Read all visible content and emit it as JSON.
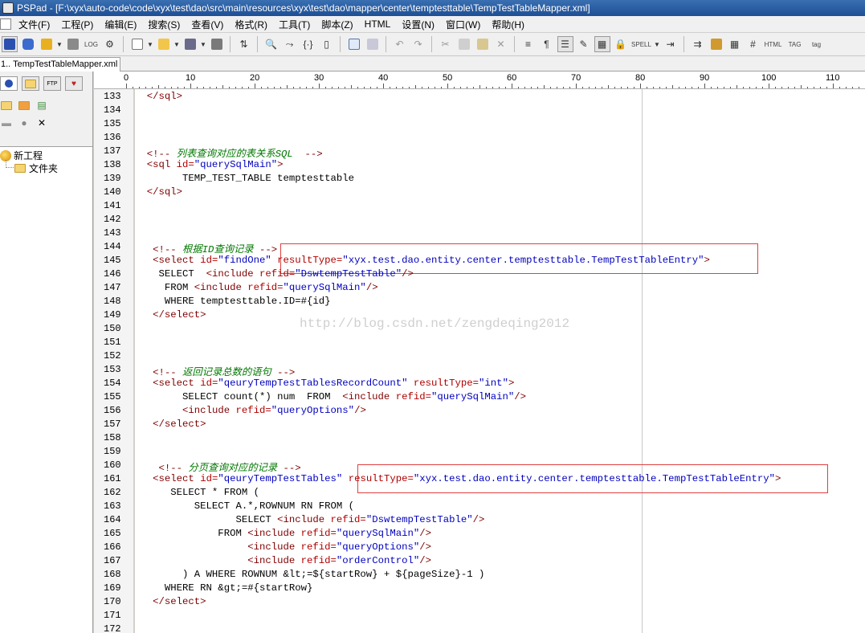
{
  "window": {
    "title": "PSPad - [F:\\xyx\\auto-code\\code\\xyx\\test\\dao\\src\\main\\resources\\xyx\\test\\dao\\mapper\\center\\temptesttable\\TempTestTableMapper.xml]"
  },
  "menu": [
    "文件(F)",
    "工程(P)",
    "编辑(E)",
    "搜索(S)",
    "查看(V)",
    "格式(R)",
    "工具(T)",
    "脚本(Z)",
    "HTML",
    "设置(N)",
    "窗口(W)",
    "帮助(H)"
  ],
  "toolbar": {
    "spell_label": "SPELL",
    "html_label": "HTML",
    "tag1_label": "TAG",
    "tag2_label": "tag"
  },
  "tab": {
    "label": "1.. TempTestTableMapper.xml"
  },
  "sidebar": {
    "project_label": "新工程",
    "folder_label": "文件夹",
    "tab_ftp": "FTP"
  },
  "ruler": [
    "0",
    "10",
    "20",
    "30",
    "40",
    "50",
    "60",
    "70",
    "80",
    "90",
    "100",
    "110"
  ],
  "watermark": "http://blog.csdn.net/zengdeqing2012",
  "lines": [
    {
      "n": "133",
      "segs": [
        [
          "tag",
          "  </sql>"
        ]
      ]
    },
    {
      "n": "134",
      "segs": []
    },
    {
      "n": "135",
      "segs": []
    },
    {
      "n": "136",
      "segs": []
    },
    {
      "n": "137",
      "segs": [
        [
          "tag",
          "  <!-- "
        ],
        [
          "cmt",
          "列表查询对应的表关系SQL"
        ],
        [
          "tag",
          "  -->"
        ]
      ]
    },
    {
      "n": "138",
      "segs": [
        [
          "tag",
          "  <sql "
        ],
        [
          "attr",
          "id="
        ],
        [
          "val",
          "\"querySqlMain\""
        ],
        [
          "tag",
          ">"
        ]
      ]
    },
    {
      "n": "139",
      "segs": [
        [
          "txt",
          "        TEMP_TEST_TABLE temptesttable"
        ]
      ]
    },
    {
      "n": "140",
      "segs": [
        [
          "tag",
          "  </sql>"
        ]
      ]
    },
    {
      "n": "141",
      "segs": []
    },
    {
      "n": "142",
      "segs": []
    },
    {
      "n": "143",
      "segs": []
    },
    {
      "n": "144",
      "segs": [
        [
          "tag",
          "   <!-- "
        ],
        [
          "cmt",
          "根据ID查询记录"
        ],
        [
          "tag",
          " -->"
        ]
      ]
    },
    {
      "n": "145",
      "segs": [
        [
          "tag",
          "   <select "
        ],
        [
          "attr",
          "id="
        ],
        [
          "val",
          "\"findOne\""
        ],
        [
          "txt",
          " "
        ],
        [
          "attr",
          "resultType="
        ],
        [
          "val",
          "\"xyx.test.dao.entity.center.temptesttable.TempTestTableEntry\""
        ],
        [
          "tag",
          ">"
        ]
      ]
    },
    {
      "n": "146",
      "segs": [
        [
          "txt",
          "    SELECT  "
        ],
        [
          "tag",
          "<include "
        ],
        [
          "attr",
          "refid="
        ],
        [
          "val",
          "\"DswtempTestTable\""
        ],
        [
          "tag",
          "/>"
        ]
      ]
    },
    {
      "n": "147",
      "segs": [
        [
          "txt",
          "     FROM "
        ],
        [
          "tag",
          "<include "
        ],
        [
          "attr",
          "refid="
        ],
        [
          "val",
          "\"querySqlMain\""
        ],
        [
          "tag",
          "/>"
        ]
      ]
    },
    {
      "n": "148",
      "segs": [
        [
          "txt",
          "     WHERE temptesttable.ID=#{id}"
        ]
      ]
    },
    {
      "n": "149",
      "segs": [
        [
          "tag",
          "   </select>"
        ]
      ]
    },
    {
      "n": "150",
      "segs": []
    },
    {
      "n": "151",
      "segs": []
    },
    {
      "n": "152",
      "segs": []
    },
    {
      "n": "153",
      "segs": [
        [
          "tag",
          "   <!-- "
        ],
        [
          "cmt",
          "返回记录总数的语句"
        ],
        [
          "tag",
          " -->"
        ]
      ]
    },
    {
      "n": "154",
      "segs": [
        [
          "tag",
          "   <select "
        ],
        [
          "attr",
          "id="
        ],
        [
          "val",
          "\"qeuryTempTestTablesRecordCount\""
        ],
        [
          "txt",
          " "
        ],
        [
          "attr",
          "resultType="
        ],
        [
          "val",
          "\"int\""
        ],
        [
          "tag",
          ">"
        ]
      ]
    },
    {
      "n": "155",
      "segs": [
        [
          "txt",
          "        SELECT count(*) num  FROM  "
        ],
        [
          "tag",
          "<include "
        ],
        [
          "attr",
          "refid="
        ],
        [
          "val",
          "\"querySqlMain\""
        ],
        [
          "tag",
          "/>"
        ]
      ]
    },
    {
      "n": "156",
      "segs": [
        [
          "txt",
          "        "
        ],
        [
          "tag",
          "<include "
        ],
        [
          "attr",
          "refid="
        ],
        [
          "val",
          "\"queryOptions\""
        ],
        [
          "tag",
          "/>"
        ]
      ]
    },
    {
      "n": "157",
      "segs": [
        [
          "tag",
          "   </select>"
        ]
      ]
    },
    {
      "n": "158",
      "segs": []
    },
    {
      "n": "159",
      "segs": []
    },
    {
      "n": "160",
      "segs": [
        [
          "tag",
          "    <!-- "
        ],
        [
          "cmt",
          "分页查询对应的记录"
        ],
        [
          "tag",
          " -->"
        ]
      ]
    },
    {
      "n": "161",
      "segs": [
        [
          "tag",
          "   <select "
        ],
        [
          "attr",
          "id="
        ],
        [
          "val",
          "\"qeuryTempTestTables\""
        ],
        [
          "txt",
          " "
        ],
        [
          "attr",
          "resultType="
        ],
        [
          "val",
          "\"xyx.test.dao.entity.center.temptesttable.TempTestTableEntry\""
        ],
        [
          "tag",
          ">"
        ]
      ]
    },
    {
      "n": "162",
      "segs": [
        [
          "txt",
          "      SELECT * FROM ("
        ]
      ]
    },
    {
      "n": "163",
      "segs": [
        [
          "txt",
          "          SELECT A.*,ROWNUM RN FROM ("
        ]
      ]
    },
    {
      "n": "164",
      "segs": [
        [
          "txt",
          "                 SELECT "
        ],
        [
          "tag",
          "<include "
        ],
        [
          "attr",
          "refid="
        ],
        [
          "val",
          "\"DswtempTestTable\""
        ],
        [
          "tag",
          "/>"
        ]
      ]
    },
    {
      "n": "165",
      "segs": [
        [
          "txt",
          "              FROM "
        ],
        [
          "tag",
          "<include "
        ],
        [
          "attr",
          "refid="
        ],
        [
          "val",
          "\"querySqlMain\""
        ],
        [
          "tag",
          "/>"
        ]
      ]
    },
    {
      "n": "166",
      "segs": [
        [
          "txt",
          "                   "
        ],
        [
          "tag",
          "<include "
        ],
        [
          "attr",
          "refid="
        ],
        [
          "val",
          "\"queryOptions\""
        ],
        [
          "tag",
          "/>"
        ]
      ]
    },
    {
      "n": "167",
      "segs": [
        [
          "txt",
          "                   "
        ],
        [
          "tag",
          "<include "
        ],
        [
          "attr",
          "refid="
        ],
        [
          "val",
          "\"orderControl\""
        ],
        [
          "tag",
          "/>"
        ]
      ]
    },
    {
      "n": "168",
      "segs": [
        [
          "txt",
          "        ) A WHERE ROWNUM &lt;=${startRow} + ${pageSize}-1 )"
        ]
      ]
    },
    {
      "n": "169",
      "segs": [
        [
          "txt",
          "     WHERE RN &gt;=#{startRow}"
        ]
      ]
    },
    {
      "n": "170",
      "segs": [
        [
          "tag",
          "   </select>"
        ]
      ]
    },
    {
      "n": "171",
      "segs": []
    },
    {
      "n": "172",
      "segs": []
    }
  ]
}
